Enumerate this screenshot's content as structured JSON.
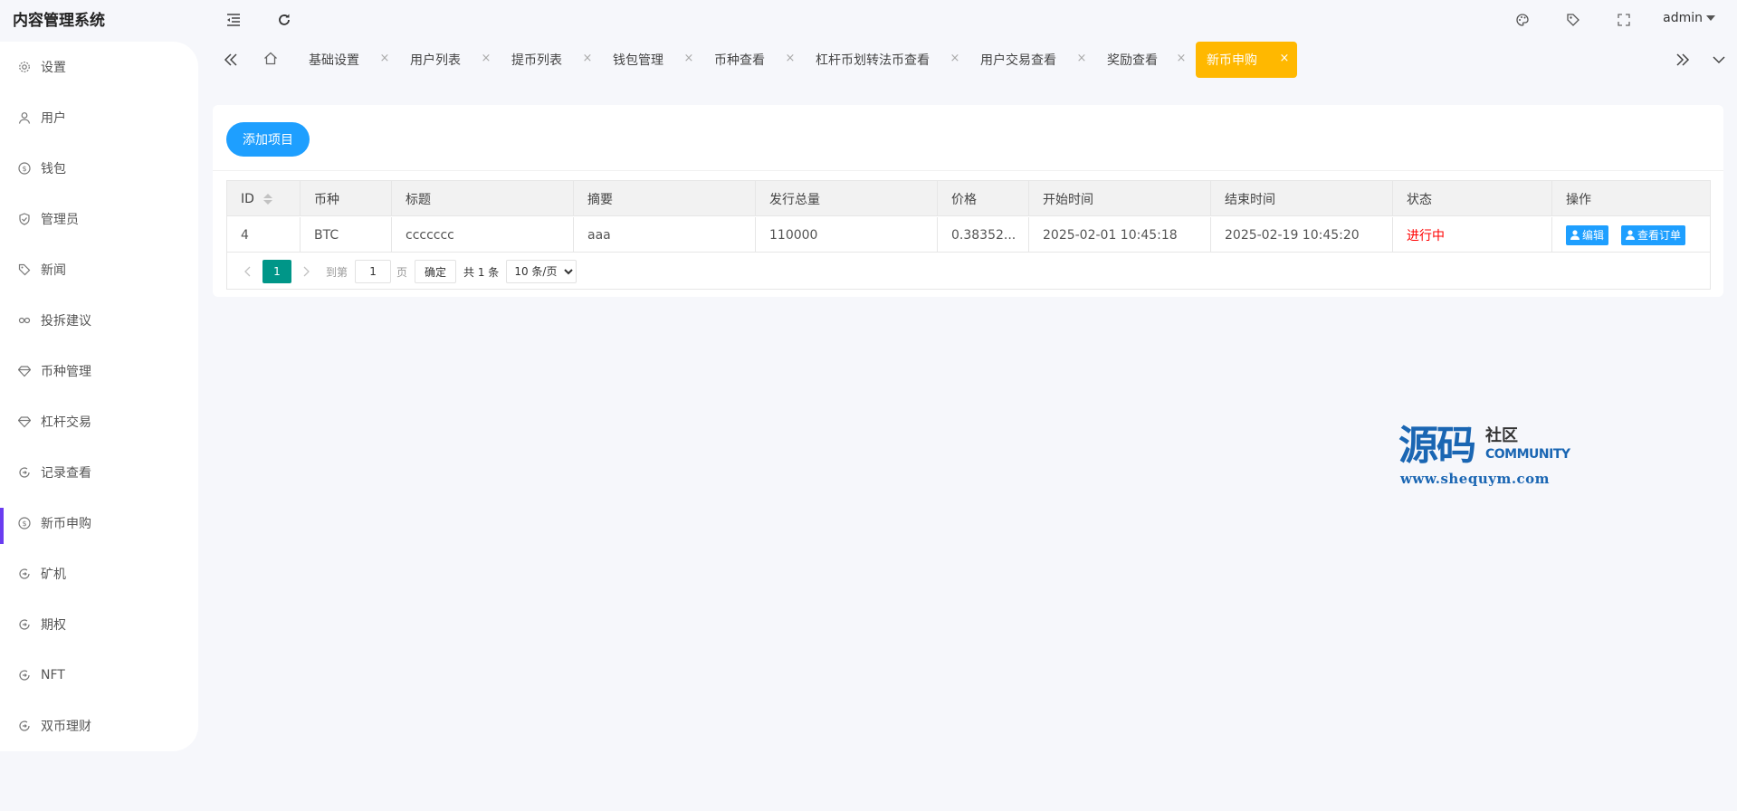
{
  "app": {
    "title": "内容管理系统"
  },
  "header": {
    "user": "admin"
  },
  "sidebar": {
    "items": [
      {
        "label": "设置",
        "icon": "gear-icon"
      },
      {
        "label": "用户",
        "icon": "user-icon"
      },
      {
        "label": "钱包",
        "icon": "dollar-icon"
      },
      {
        "label": "管理员",
        "icon": "shield-icon"
      },
      {
        "label": "新闻",
        "icon": "tag-icon"
      },
      {
        "label": "投拆建议",
        "icon": "link-icon"
      },
      {
        "label": "币种管理",
        "icon": "diamond-icon"
      },
      {
        "label": "杠杆交易",
        "icon": "diamond-icon"
      },
      {
        "label": "记录查看",
        "icon": "circle-arrow-icon"
      },
      {
        "label": "新币申购",
        "icon": "dollar-icon"
      },
      {
        "label": "矿机",
        "icon": "circle-arrow-icon"
      },
      {
        "label": "期权",
        "icon": "circle-arrow-icon"
      },
      {
        "label": "NFT",
        "icon": "circle-arrow-icon"
      },
      {
        "label": "双币理财",
        "icon": "circle-arrow-icon"
      }
    ],
    "active_color": "#6a3cf0"
  },
  "tabs": [
    {
      "label": "基础设置"
    },
    {
      "label": "用户列表"
    },
    {
      "label": "提币列表"
    },
    {
      "label": "钱包管理"
    },
    {
      "label": "币种查看"
    },
    {
      "label": "杠杆币划转法币查看"
    },
    {
      "label": "用户交易查看"
    },
    {
      "label": "奖励查看"
    },
    {
      "label": "新币申购",
      "active": true
    }
  ],
  "toolbar": {
    "add_label": "添加项目"
  },
  "table": {
    "headers": [
      "ID",
      "币种",
      "标题",
      "摘要",
      "发行总量",
      "价格",
      "开始时间",
      "结束时间",
      "状态",
      "操作"
    ],
    "rows": [
      {
        "id": "4",
        "coin": "BTC",
        "title": "ccccccc",
        "summary": "aaa",
        "total": "110000",
        "price": "0.38352...",
        "start": "2025-02-01 10:45:18",
        "end": "2025-02-19 10:45:20",
        "status": "进行中",
        "edit_label": "编辑",
        "orders_label": "查看订单"
      }
    ]
  },
  "pager": {
    "current": "1",
    "goto_label": "到第",
    "page_value": "1",
    "page_unit": "页",
    "confirm_label": "确定",
    "total_label": "共 1 条",
    "size_label": "10 条/页"
  },
  "watermark": {
    "big": "源码",
    "small": "社区",
    "community": "COMMUNITY",
    "url": "www.shequym.com"
  },
  "colors": {
    "accent": "#1e9fff",
    "active_tab": "#ffb800",
    "pager": "#009688",
    "status": "#ff0000"
  }
}
